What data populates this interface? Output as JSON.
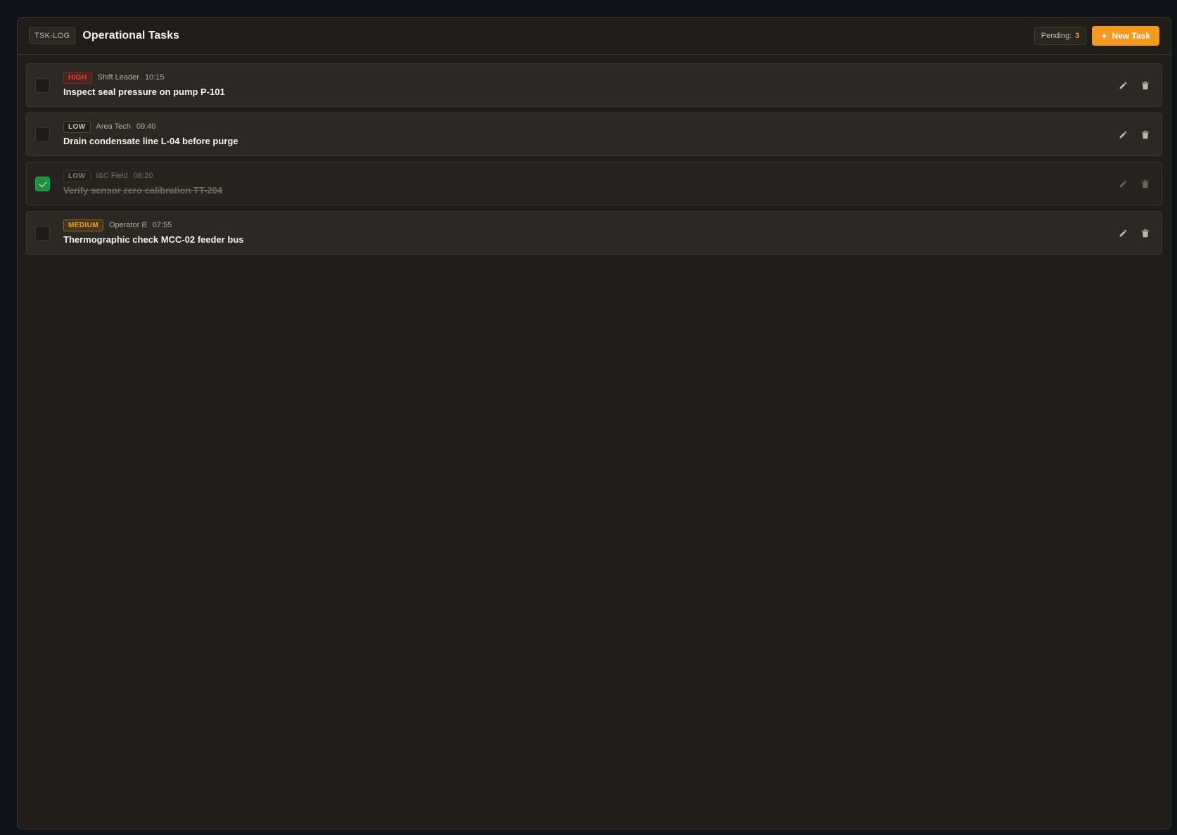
{
  "header": {
    "tag": "TSK-LOG",
    "title": "Operational Tasks",
    "pending_label": "Pending:",
    "pending_count": "3",
    "new_task_label": "New Task",
    "new_task_icon": "plus-icon"
  },
  "colors": {
    "accent": "#f59a1c",
    "high": "#e0493a",
    "medium": "#e8a02a",
    "done": "#1f8f45"
  },
  "tasks": [
    {
      "priority": "HIGH",
      "owner": "Shift Leader",
      "time": "10:15",
      "title": "Inspect seal pressure on pump P-101",
      "done": false
    },
    {
      "priority": "LOW",
      "owner": "Area Tech",
      "time": "09:40",
      "title": "Drain condensate line L-04 before purge",
      "done": false
    },
    {
      "priority": "LOW",
      "owner": "I&C Field",
      "time": "08:20",
      "title": "Verify sensor zero calibration TT-204",
      "done": true
    },
    {
      "priority": "MEDIUM",
      "owner": "Operator B",
      "time": "07:55",
      "title": "Thermographic check MCC-02 feeder bus",
      "done": false
    }
  ]
}
